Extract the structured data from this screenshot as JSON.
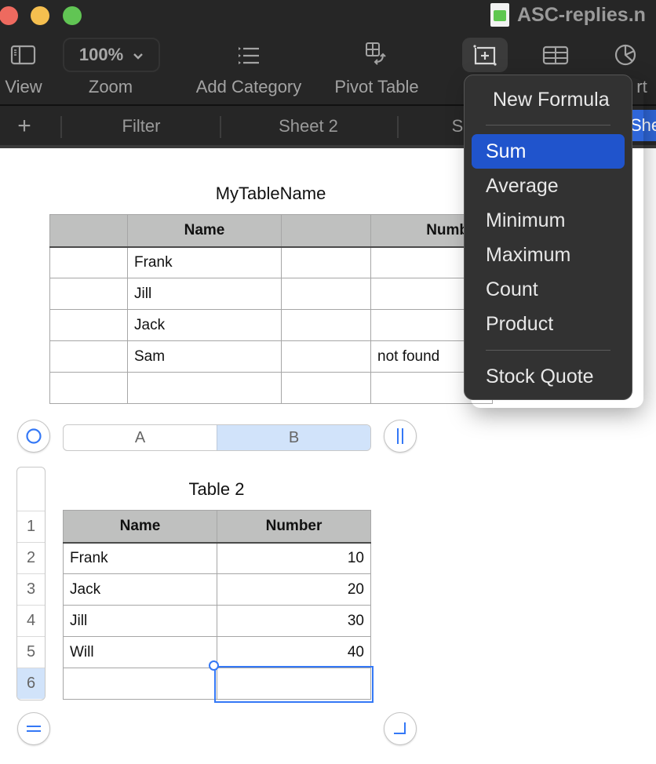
{
  "window": {
    "title": "ASC-replies.n",
    "traffic_lights": [
      "close",
      "minimize",
      "maximize"
    ]
  },
  "toolbar": {
    "view_label": "View",
    "zoom_value": "100%",
    "zoom_label": "Zoom",
    "add_category_label": "Add Category",
    "pivot_table_label": "Pivot Table",
    "chart_label_partial": "rt",
    "icons": {
      "view": "sidebar-icon",
      "add_category": "list-icon",
      "pivot_table": "pivot-table-icon",
      "formula": "insert-formula-icon",
      "table": "table-icon",
      "chart": "pie-chart-icon"
    }
  },
  "tabs": {
    "add_symbol": "+",
    "items": [
      {
        "label": "Filter"
      },
      {
        "label": "Sheet 2"
      },
      {
        "label": "S"
      }
    ],
    "active_partial": "She"
  },
  "formula_menu": {
    "items": [
      {
        "label": "New Formula"
      },
      {
        "label": "Sum",
        "highlighted": true
      },
      {
        "label": "Average"
      },
      {
        "label": "Minimum"
      },
      {
        "label": "Maximum"
      },
      {
        "label": "Count"
      },
      {
        "label": "Product"
      },
      {
        "label": "Stock Quote"
      }
    ]
  },
  "table1": {
    "title": "MyTableName",
    "headers": [
      "",
      "Name",
      "",
      "Number"
    ],
    "rows": [
      [
        "",
        "Frank",
        "",
        ""
      ],
      [
        "",
        "Jill",
        "",
        ""
      ],
      [
        "",
        "Jack",
        "",
        ""
      ],
      [
        "",
        "Sam",
        "",
        "not found"
      ],
      [
        "",
        "",
        "",
        ""
      ]
    ]
  },
  "table2": {
    "title": "Table 2",
    "column_headers": [
      "A",
      "B"
    ],
    "selected_column": "B",
    "row_headers": [
      "1",
      "2",
      "3",
      "4",
      "5",
      "6"
    ],
    "selected_row": "6",
    "headers": [
      "Name",
      "Number"
    ],
    "rows": [
      [
        "Frank",
        "10"
      ],
      [
        "Jack",
        "20"
      ],
      [
        "Jill",
        "30"
      ],
      [
        "Will",
        "40"
      ],
      [
        "",
        ""
      ]
    ]
  }
}
